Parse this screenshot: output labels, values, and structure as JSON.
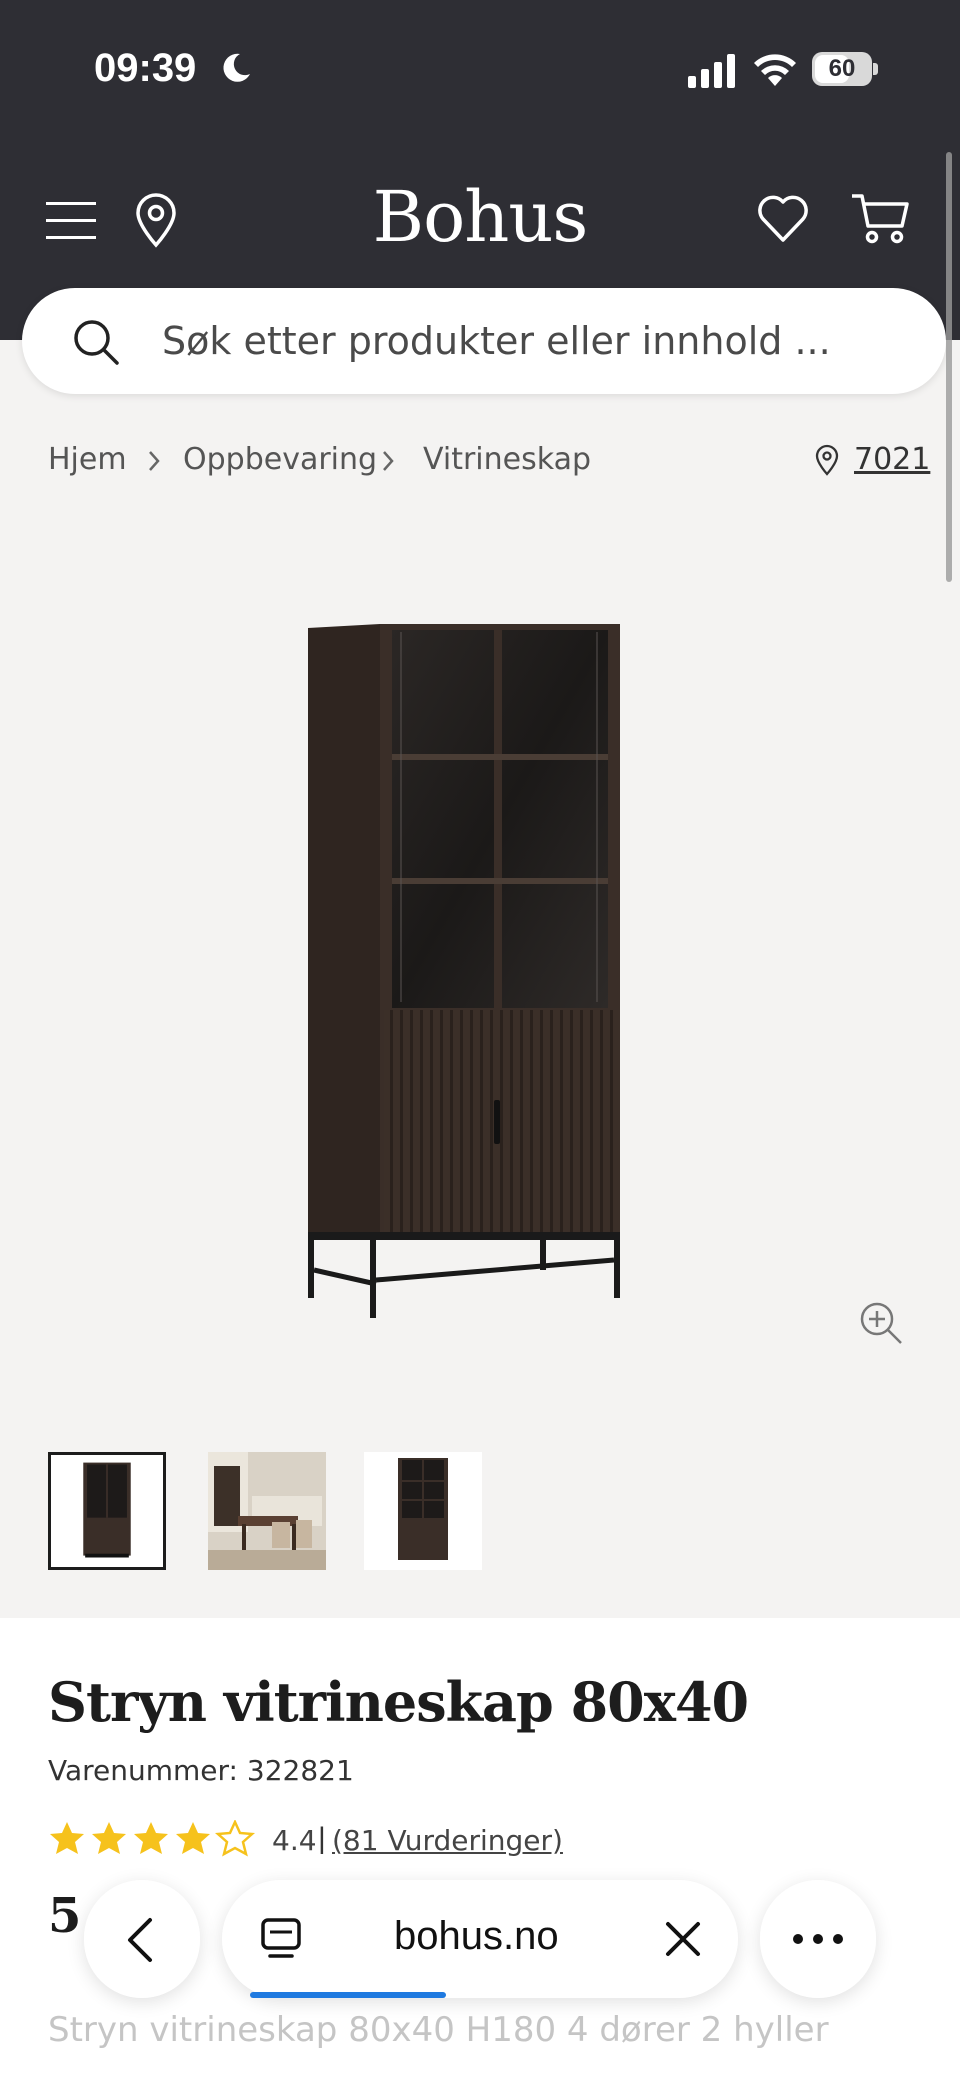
{
  "status_bar": {
    "time": "09:39",
    "battery": "60"
  },
  "header": {
    "logo": "Bohus"
  },
  "search": {
    "placeholder": "Søk etter produkter eller innhold ..."
  },
  "breadcrumb": {
    "items": [
      "Hjem",
      "Oppbevaring",
      "Vitrineskap"
    ],
    "location": "7021"
  },
  "product": {
    "title": "Stryn vitrineskap 80x40",
    "sku": "Varenummer: 322821",
    "rating_value": "4.4",
    "rating_separator": "|",
    "rating_count": "(81 Vurderinger)",
    "rating_stars": 4.4,
    "price_partial": "5",
    "description_partial": "Stryn vitrineskap 80x40 H180 4 dører 2 hyller"
  },
  "browser": {
    "domain": "bohus.no",
    "load_progress": 0.38
  },
  "colors": {
    "header_bg": "#2e2e34",
    "page_bg": "#f4f3f2",
    "star": "#f6c21c",
    "progress": "#1f7ae0"
  },
  "icons": [
    "menu-icon",
    "location-pin-icon",
    "heart-icon",
    "cart-icon",
    "search-icon",
    "zoom-in-icon",
    "tabs-icon",
    "close-icon",
    "more-icon",
    "back-icon"
  ]
}
